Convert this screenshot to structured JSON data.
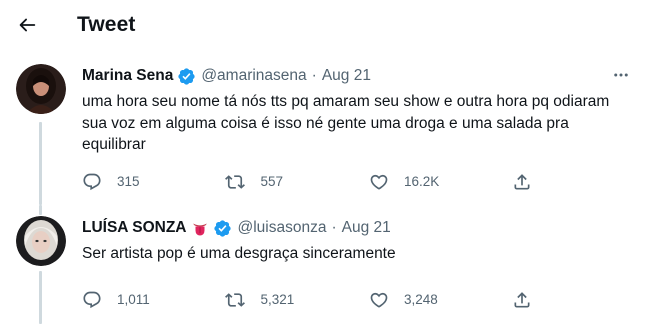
{
  "header": {
    "title": "Tweet"
  },
  "tweets": [
    {
      "name": "Marina Sena",
      "handle": "@amarinasena",
      "separator": "·",
      "date": "Aug 21",
      "text": "uma hora seu nome tá nós tts pq amaram seu show e outra hora pq odiaram sua voz em alguma coisa é isso né gente uma droga e uma salada pra equilibrar",
      "replies": "315",
      "retweets": "557",
      "likes": "16.2K",
      "verified": true
    },
    {
      "name": "LUÍSA SONZA",
      "name_emoji": "tongue-emoji",
      "handle": "@luisasonza",
      "separator": "·",
      "date": "Aug 21",
      "text": "Ser artista pop é uma desgraça sinceramente",
      "replies": "1,011",
      "retweets": "5,321",
      "likes": "3,248",
      "verified": true
    }
  ],
  "colors": {
    "verified": "#1d9bf0",
    "secondary_text": "#536471",
    "thread_line": "#cfd9de",
    "emoji_red": "#e0245e"
  }
}
